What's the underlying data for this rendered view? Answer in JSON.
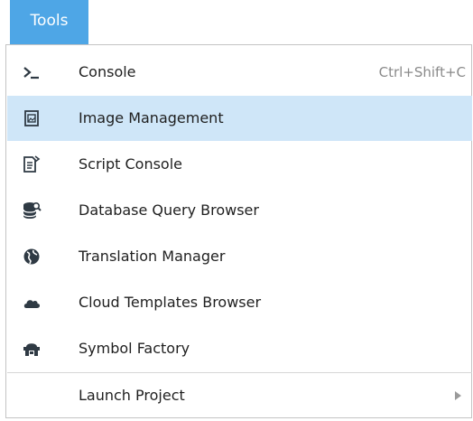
{
  "menubar": {
    "active_menu": "Tools"
  },
  "menu": {
    "items": [
      {
        "label": "Console",
        "shortcut": "Ctrl+Shift+C",
        "icon": "terminal-icon"
      },
      {
        "label": "Image Management",
        "icon": "image-icon",
        "selected": true
      },
      {
        "label": "Script Console",
        "icon": "script-console-icon"
      },
      {
        "label": "Database Query Browser",
        "icon": "database-search-icon"
      },
      {
        "label": "Translation Manager",
        "icon": "globe-icon"
      },
      {
        "label": "Cloud Templates Browser",
        "icon": "cloud-icon"
      },
      {
        "label": "Symbol Factory",
        "icon": "symbol-factory-icon"
      },
      {
        "label": "Launch Project",
        "icon": "submenu-arrow-icon",
        "has_submenu": true
      }
    ]
  },
  "colors": {
    "accent": "#4ea6e6",
    "selection": "#cfe6f8",
    "icon": "#2f3a44"
  }
}
